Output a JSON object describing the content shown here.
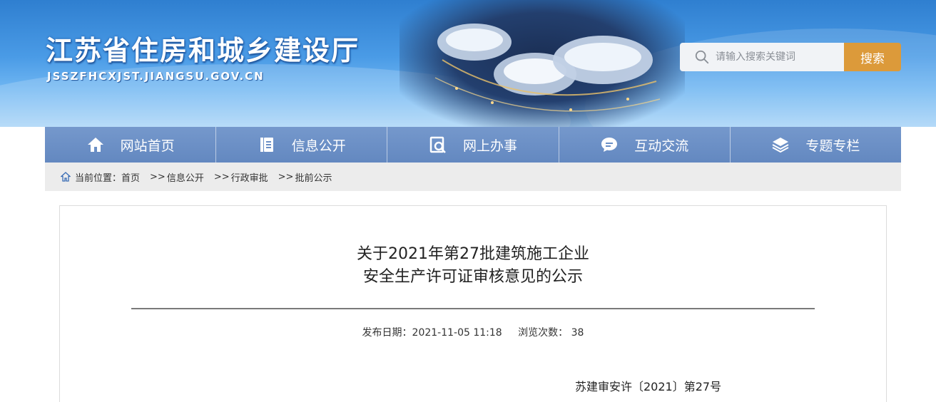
{
  "header": {
    "site_title": "江苏省住房和城乡建设厅",
    "site_domain": "JSSZFHCXJST.JIANGSU.GOV.CN",
    "search": {
      "placeholder": "请输入搜索关键词",
      "button_label": "搜索",
      "icon": "search-icon"
    }
  },
  "nav": {
    "items": [
      {
        "label": "网站首页",
        "icon": "home-icon"
      },
      {
        "label": "信息公开",
        "icon": "document-icon"
      },
      {
        "label": "网上办事",
        "icon": "magnifier-doc-icon"
      },
      {
        "label": "互动交流",
        "icon": "chat-icon"
      },
      {
        "label": "专题专栏",
        "icon": "layers-icon"
      }
    ]
  },
  "breadcrumb": {
    "prefix": "当前位置：",
    "items": [
      "首页",
      "信息公开",
      "行政审批",
      "批前公示"
    ],
    "separator": ">>"
  },
  "article": {
    "title_line1": "关于2021年第27批建筑施工企业",
    "title_line2": "安全生产许可证审核意见的公示",
    "publish_label": "发布日期：",
    "publish_date": "2021-11-05 11:18",
    "views_label": "浏览次数：",
    "views_count": "38",
    "doc_number": "苏建审安许〔2021〕第27号"
  },
  "colors": {
    "nav_background": "#6a8fc6",
    "search_button": "#dc9a3a",
    "breadcrumb_background": "#ececec"
  }
}
